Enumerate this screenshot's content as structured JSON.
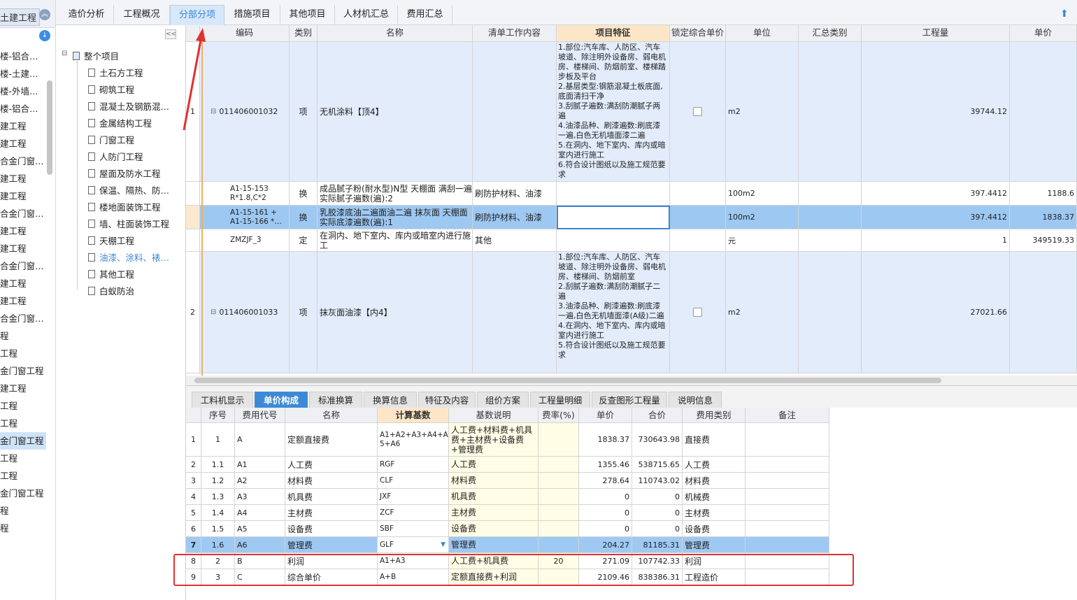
{
  "sidebar": {
    "title": "土建工程",
    "items": [
      "楼-铝合…",
      "楼-土建…",
      "楼-外墙…",
      "楼-铝合…",
      "建工程",
      "建工程",
      "合金门窗…",
      "建工程",
      "建工程",
      "合金门窗…",
      "建工程",
      "建工程",
      "合金门窗…",
      "建工程",
      "建工程",
      "合金门窗…",
      "程",
      "工程",
      "金门窗工程",
      "建工程",
      "工程",
      "工程",
      "金门窗工程",
      "工程",
      "工程",
      "金门窗工程",
      "程",
      "程"
    ],
    "selected_index": 22
  },
  "tree": {
    "root": "整个项目",
    "children": [
      "土石方工程",
      "砌筑工程",
      "混凝土及钢筋混…",
      "金属结构工程",
      "门窗工程",
      "人防门工程",
      "屋面及防水工程",
      "保温、隔热、防…",
      "楼地面装饰工程",
      "墙、柱面装饰工程",
      "天棚工程",
      "油漆、涂料、裱…",
      "其他工程",
      "白蚁防治"
    ],
    "active_index": 11
  },
  "tabs": [
    "造价分析",
    "工程概况",
    "分部分项",
    "措施项目",
    "其他项目",
    "人材机汇总",
    "费用汇总"
  ],
  "active_tab": "分部分项",
  "upper": {
    "headers": [
      "编码",
      "类别",
      "名称",
      "清单工作内容",
      "项目特征",
      "锁定综合单价",
      "单位",
      "汇总类别",
      "工程量",
      "单价"
    ],
    "rows": [
      {
        "no": "1",
        "code": "011406001032",
        "type": "项",
        "name": "无机涂料【顶4】",
        "work": "",
        "feature": "1.部位:汽车库、人防区、汽车坡道、除注明外设备房、弱电机房、楼梯间、防烟前室、楼梯踏步板及平台\n2.基层类型:钢筋混凝土板底面,底面清扫干净\n3.刮腻子遍数:满刮防潮腻子两遍\n4.油漆品种、刷漆遍数:刷底漆一遍,白色无机墙面漆二遍\n5.在洞内、地下室内、库内或暗室内进行施工\n6.符合设计图纸以及施工规范要求",
        "unit": "m2",
        "qty": "39744.12",
        "price": ""
      },
      {
        "no": "",
        "code": "A1-15-153\nR*1.8,C*2",
        "type": "换",
        "name": "成品腻子粉(耐水型)N型 天棚面 满刮一遍  实际腻子遍数(遍):2",
        "work": "刷防护材料、油漆",
        "feature": "",
        "unit": "100m2",
        "qty": "397.4412",
        "price": "1188.6"
      },
      {
        "no": "",
        "code": "A1-15-161 +\nA1-15-166 *…",
        "type": "换",
        "name": "乳胶漆底油二遍面油二遍 抹灰面 天棚面  实际底漆遍数(遍):1",
        "work": "刷防护材料、油漆",
        "feature": "",
        "unit": "100m2",
        "qty": "397.4412",
        "price": "1838.37"
      },
      {
        "no": "",
        "code": "ZMZJF_3",
        "type": "定",
        "name": "在洞内、地下室内、库内或暗室内进行施工",
        "work": "其他",
        "feature": "",
        "unit": "元",
        "qty": "1",
        "price": "349519.33"
      },
      {
        "no": "2",
        "code": "011406001033",
        "type": "项",
        "name": "抹灰面油漆【内4】",
        "work": "",
        "feature": "1.部位:汽车库、人防区、汽车坡道、除注明外设备房、弱电机房、楼梯间、防烟前室\n2.刮腻子遍数:满刮防潮腻子二遍\n3.油漆品种、刷漆遍数:刷底漆一遍,白色无机墙面漆(A级)二遍\n4.在洞内、地下室内、库内或暗室内进行施工\n5.符合设计图纸以及施工规范要求",
        "unit": "m2",
        "qty": "27021.66",
        "price": ""
      }
    ]
  },
  "lower_tabs": [
    "工料机显示",
    "单价构成",
    "标准换算",
    "换算信息",
    "特征及内容",
    "组价方案",
    "工程量明细",
    "反查图形工程量",
    "说明信息"
  ],
  "lower_active": "单价构成",
  "lower": {
    "headers": [
      "序号",
      "费用代号",
      "名称",
      "计算基数",
      "基数说明",
      "费率(%)",
      "单价",
      "合价",
      "费用类别",
      "备注"
    ],
    "rows": [
      {
        "i": "1",
        "seq": "1",
        "code": "A",
        "name": "定额直接费",
        "base": "A1+A2+A3+A4+A5+A6",
        "desc": "人工费+材料费+机具费+主材费+设备费+管理费",
        "rate": "",
        "price": "1838.37",
        "total": "730643.98",
        "cat": "直接费"
      },
      {
        "i": "2",
        "seq": "1.1",
        "code": "A1",
        "name": "人工费",
        "base": "RGF",
        "desc": "人工费",
        "rate": "",
        "price": "1355.46",
        "total": "538715.65",
        "cat": "人工费"
      },
      {
        "i": "3",
        "seq": "1.2",
        "code": "A2",
        "name": "材料费",
        "base": "CLF",
        "desc": "材料费",
        "rate": "",
        "price": "278.64",
        "total": "110743.02",
        "cat": "材料费"
      },
      {
        "i": "4",
        "seq": "1.3",
        "code": "A3",
        "name": "机具费",
        "base": "JXF",
        "desc": "机具费",
        "rate": "",
        "price": "0",
        "total": "0",
        "cat": "机械费"
      },
      {
        "i": "5",
        "seq": "1.4",
        "code": "A4",
        "name": "主材费",
        "base": "ZCF",
        "desc": "主材费",
        "rate": "",
        "price": "0",
        "total": "0",
        "cat": "主材费"
      },
      {
        "i": "6",
        "seq": "1.5",
        "code": "A5",
        "name": "设备费",
        "base": "SBF",
        "desc": "设备费",
        "rate": "",
        "price": "0",
        "total": "0",
        "cat": "设备费"
      },
      {
        "i": "7",
        "seq": "1.6",
        "code": "A6",
        "name": "管理费",
        "base": "GLF",
        "desc": "管理费",
        "rate": "",
        "price": "204.27",
        "total": "81185.31",
        "cat": "管理费"
      },
      {
        "i": "8",
        "seq": "2",
        "code": "B",
        "name": "利润",
        "base": "A1+A3",
        "desc": "人工费+机具费",
        "rate": "20",
        "price": "271.09",
        "total": "107742.33",
        "cat": "利润"
      },
      {
        "i": "9",
        "seq": "3",
        "code": "C",
        "name": "综合单价",
        "base": "A+B",
        "desc": "定额直接费+利润",
        "rate": "",
        "price": "2109.46",
        "total": "838386.31",
        "cat": "工程造价"
      }
    ]
  }
}
